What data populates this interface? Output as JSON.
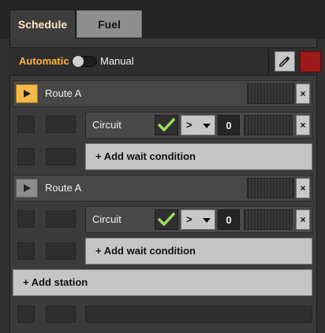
{
  "tabs": [
    {
      "label": "Schedule",
      "active": true
    },
    {
      "label": "Fuel",
      "active": false
    }
  ],
  "mode": {
    "automatic_label": "Automatic",
    "manual_label": "Manual",
    "automatic_on": false
  },
  "toolbar": {
    "picker_icon": "eyedropper-icon",
    "color_swatch": "#9e1a1a"
  },
  "stations": [
    {
      "name": "Route A",
      "current": true,
      "close_label": "×",
      "conditions": [
        {
          "label": "Circuit",
          "comparator": ">",
          "value": "0",
          "close_label": "×"
        }
      ],
      "add_wait_label": "+ Add wait condition"
    },
    {
      "name": "Route A",
      "current": false,
      "close_label": "×",
      "conditions": [
        {
          "label": "Circuit",
          "comparator": ">",
          "value": "0",
          "close_label": "×"
        }
      ],
      "add_wait_label": "+ Add wait condition"
    }
  ],
  "add_station_label": "+ Add station",
  "colors": {
    "accent": "#f5b94a",
    "automatic_text": "#ffb53a",
    "check": "#9be05a"
  }
}
